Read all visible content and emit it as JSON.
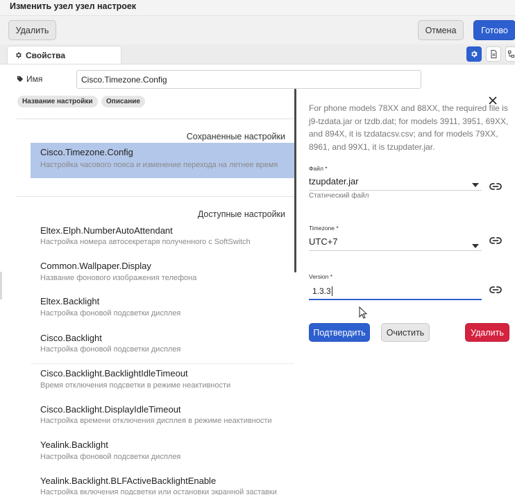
{
  "header": {
    "title": "Изменить узел узел настроек"
  },
  "toolbar": {
    "delete": "Удалить",
    "cancel": "Отмена",
    "done": "Готово"
  },
  "tab": {
    "label": "Свойства"
  },
  "name_field": {
    "label": "Имя",
    "value": "Cisco.Timezone.Config"
  },
  "chips": {
    "setting_name": "Название настройки",
    "description": "Описание"
  },
  "saved": {
    "heading": "Сохраненные настройки",
    "items": [
      {
        "title": "Cisco.Timezone.Config",
        "subtitle": "Настройка часового пояса и изменение перехода на летнее время"
      }
    ]
  },
  "available": {
    "heading": "Доступные настройки",
    "items": [
      {
        "title": "Eltex.Elph.NumberAutoAttendant",
        "subtitle": "Настройка номера автосекретаря полученного с SoftSwitch"
      },
      {
        "title": "Common.Wallpaper.Display",
        "subtitle": "Название фонового изображения телефона"
      },
      {
        "title": "Eltex.Backlight",
        "subtitle": "Настройка фоновой подсветки дисплея"
      },
      {
        "title": "Cisco.Backlight",
        "subtitle": "Настройка фоновой подсветки дисплея"
      },
      {
        "title": "Cisco.Backlight.BacklightIdleTimeout",
        "subtitle": "Время отключения подсветки в режиме неактивности"
      },
      {
        "title": "Cisco.Backlight.DisplayIdleTimeout",
        "subtitle": "Настройка времени отключения дисплея в режиме неактивности"
      },
      {
        "title": "Yealink.Backlight",
        "subtitle": "Настройка фоновой подсветки дисплея"
      },
      {
        "title": "Yealink.Backlight.BLFActiveBacklightEnable",
        "subtitle": "Настройка включения подсветки или остановки экранной заставки"
      }
    ]
  },
  "detail": {
    "description": "For phone models 78XX and 88XX, the required file is j9-tzdata.jar or tzdb.dat; for models 3911, 3951, 69XX, and 894X, it is tzdatacsv.csv; and for models 79XX, 8961, and 99X1, it is tzupdater.jar.",
    "file": {
      "label": "Файл *",
      "value": "tzupdater.jar",
      "helper": "Статический файл"
    },
    "timezone": {
      "label": "Timezone *",
      "value": "UTC+7"
    },
    "version": {
      "label": "Version *",
      "value": "1.3.3"
    },
    "buttons": {
      "confirm": "Подтвердить",
      "clear": "Очистить",
      "delete": "Удалить"
    }
  },
  "colors": {
    "primary": "#2d5fcf",
    "danger": "#d4233f",
    "selected": "#b3c7ea"
  }
}
